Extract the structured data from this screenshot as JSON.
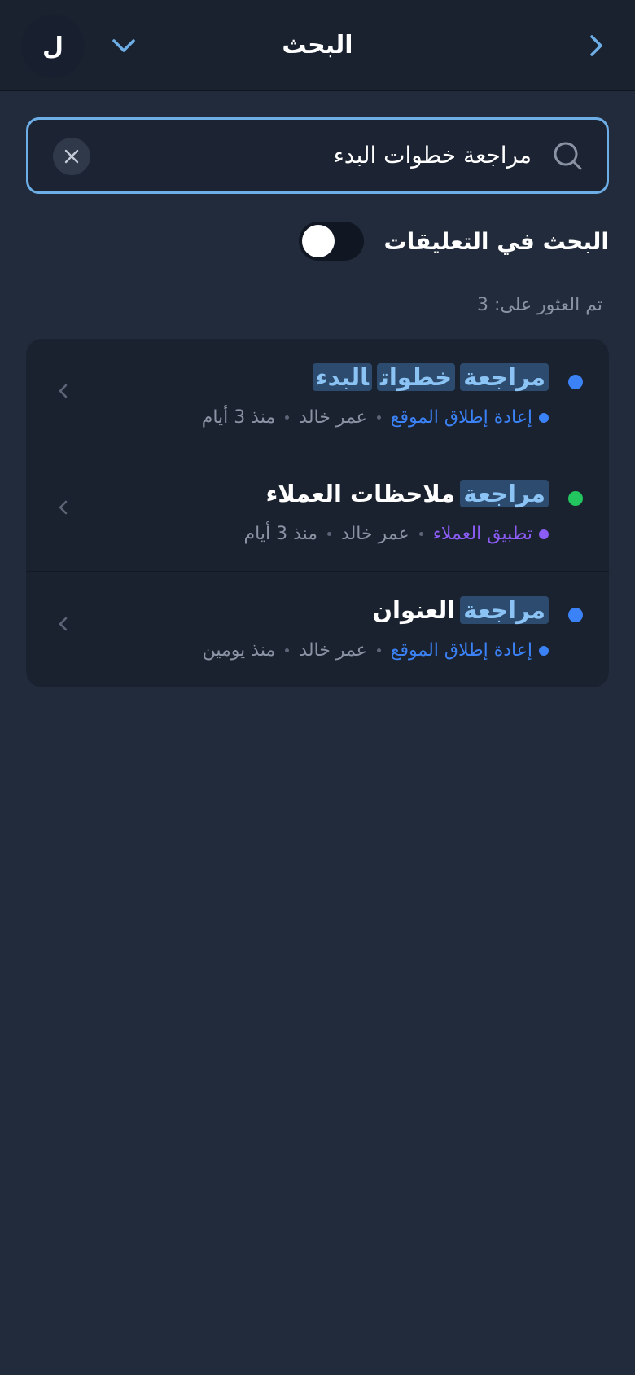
{
  "header": {
    "title": "البحث",
    "avatar_initial": "ل",
    "back_icon": "chevron-right-icon",
    "dropdown_icon": "chevron-down-icon"
  },
  "search": {
    "value": "مراجعة خطوات البدء",
    "icon": "search-icon",
    "clear_icon": "close-icon"
  },
  "comments_toggle": {
    "label": "البحث في التعليقات",
    "enabled": true
  },
  "results_count": "تم العثور على: 3",
  "results": [
    {
      "title_parts": [
        "مراجعة",
        "خطوات",
        "البدء"
      ],
      "status_color": "#3b82f6",
      "project": "إعادة إطلاق الموقع",
      "project_color": "#3b82f6",
      "author": "عمر خالد",
      "time": "منذ 3 أيام"
    },
    {
      "title_parts": [
        "مراجعة",
        "ملاحظات العملاء"
      ],
      "status_color": "#22c55e",
      "project": "تطبيق العملاء",
      "project_color": "#8b5cf6",
      "author": "عمر خالد",
      "time": "منذ 3 أيام"
    },
    {
      "title_parts": [
        "مراجعة",
        "العنوان"
      ],
      "status_color": "#3b82f6",
      "project": "إعادة إطلاق الموقع",
      "project_color": "#3b82f6",
      "author": "عمر خالد",
      "time": "منذ يومين"
    }
  ],
  "colors": {
    "background": "#212b3b",
    "header_bg": "#1a2230",
    "accent": "#6eaee6",
    "highlight_bg": "#2c4b6e",
    "highlight_text": "#8cc3f5"
  }
}
